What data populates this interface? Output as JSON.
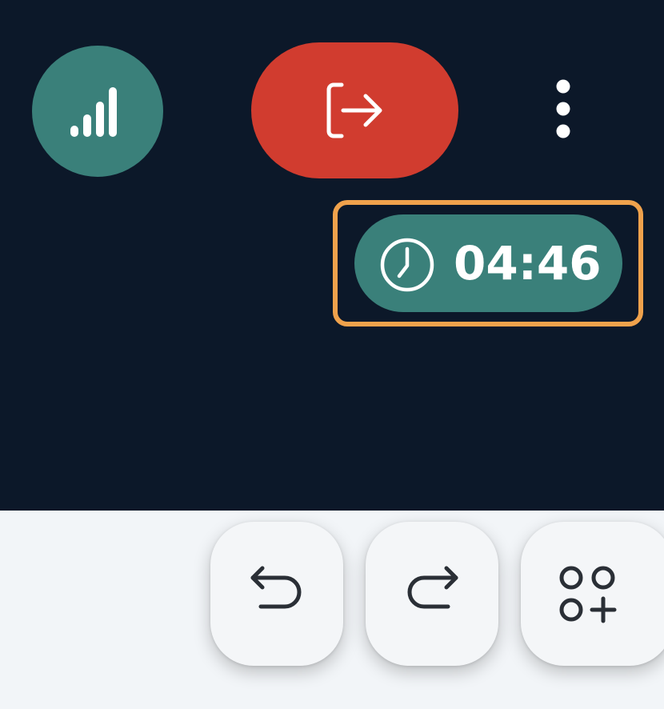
{
  "meeting_controls": {
    "signal_icon": "signal-strength-icon",
    "leave_icon": "leave-arrow-icon",
    "more_icon": "vertical-ellipsis-icon"
  },
  "timer": {
    "icon": "clock-icon",
    "value": "04:46",
    "highlight_color": "#f0a24c"
  },
  "toolbar": {
    "undo_icon": "undo-icon",
    "redo_icon": "redo-icon",
    "apps_icon": "add-apps-icon"
  },
  "colors": {
    "background_dark": "#0c1829",
    "teal": "#3a807a",
    "leave_red": "#d13c2f",
    "toolbar_bg": "#f2f5f8"
  }
}
